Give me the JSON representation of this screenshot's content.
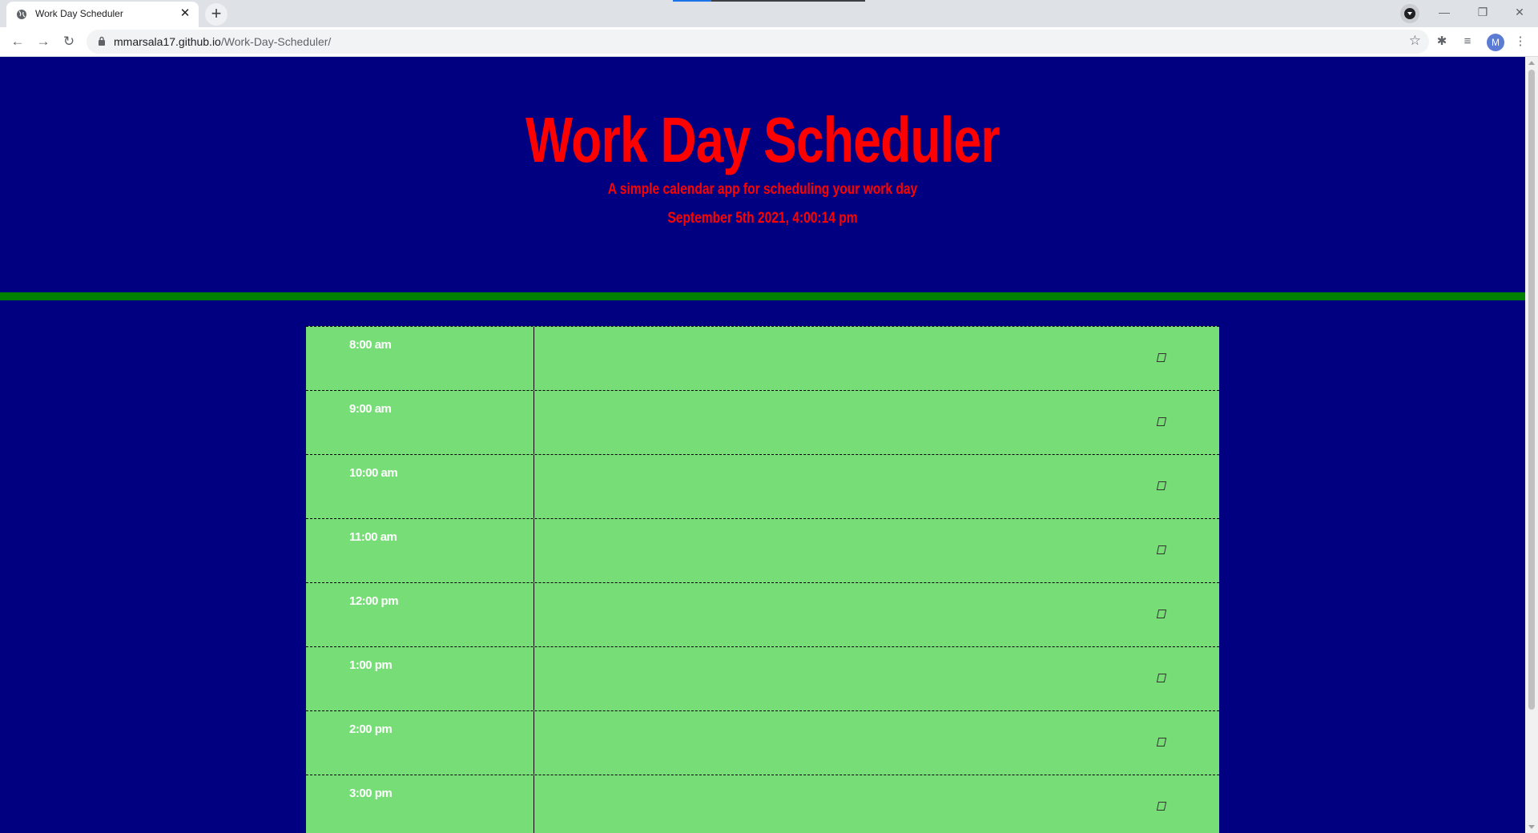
{
  "browser": {
    "tab_title": "Work Day Scheduler",
    "tab_close": "✕",
    "new_tab": "+",
    "url_host": "mmarsala17.github.io",
    "url_path": "/Work-Day-Scheduler/",
    "profile_initial": "M",
    "window_controls": {
      "minimize": "—",
      "restore": "❐",
      "close": "✕"
    },
    "nav": {
      "back": "←",
      "forward": "→",
      "reload": "↻"
    },
    "star": "☆",
    "extensions_icon": "✱",
    "reading_list_icon": "≡",
    "menu_icon": "⋮"
  },
  "header": {
    "title": "Work Day Scheduler",
    "lead": "A simple calendar app for scheduling your work day",
    "current_day": "September 5th 2021, 4:00:14 pm"
  },
  "schedule": {
    "rows": [
      {
        "hour": "8:00 am"
      },
      {
        "hour": "9:00 am"
      },
      {
        "hour": "10:00 am"
      },
      {
        "hour": "11:00 am"
      },
      {
        "hour": "12:00 pm"
      },
      {
        "hour": "1:00 pm"
      },
      {
        "hour": "2:00 pm"
      },
      {
        "hour": "3:00 pm"
      }
    ]
  },
  "colors": {
    "page_background": "#000080",
    "title": "#ff0000",
    "divider": "#008000",
    "row_background": "#77dd77",
    "hour_text": "#ffffff"
  },
  "icons": {
    "save": "save-icon",
    "favicon": "globe-icon",
    "lock": "lock-icon"
  }
}
